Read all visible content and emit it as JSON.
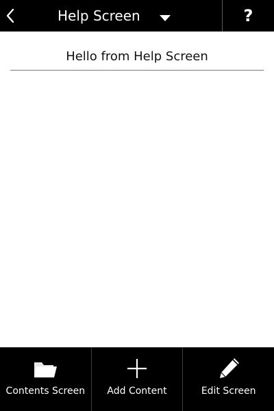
{
  "header": {
    "title": "Help Screen",
    "help_label": "?"
  },
  "content": {
    "greeting": "Hello from Help Screen"
  },
  "tabs": [
    {
      "label": "Contents Screen",
      "icon": "folder-icon"
    },
    {
      "label": "Add Content",
      "icon": "plus-icon"
    },
    {
      "label": "Edit Screen",
      "icon": "pencil-icon"
    }
  ],
  "colors": {
    "bar_background": "#000000",
    "bar_text": "#ffffff",
    "content_background": "#ffffff"
  }
}
